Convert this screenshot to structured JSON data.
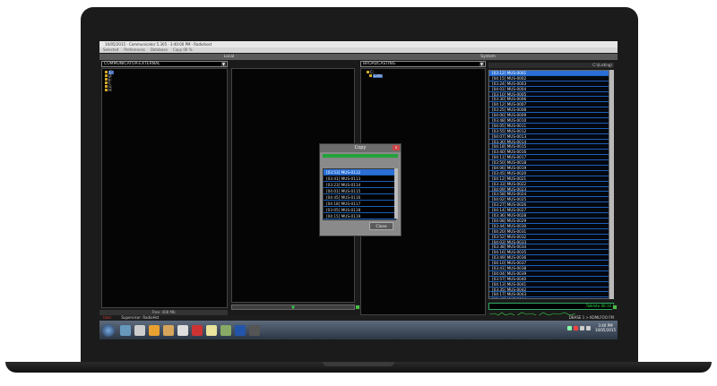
{
  "window": {
    "title": "10/05/2015 · Communicator 5.305 · 3:40:00 PM · Radiohost"
  },
  "menu": [
    "Selected",
    "Preferences",
    "Database",
    "Copy 00 %"
  ],
  "headers": {
    "local": "Local",
    "system": "System"
  },
  "local": {
    "path": "COMMUNICATOR-EXTERNAL",
    "free": "Free: 408 Mb",
    "tree": [
      "C:",
      "D:",
      "E:",
      "F:",
      "G:",
      "H:"
    ]
  },
  "system": {
    "path": "BROADCASTING",
    "header_right": "C:\\(Listing)",
    "tree": [
      "C:",
      "Lists"
    ],
    "items": [
      "[03:12] MUS-0001",
      "[04:15] MUS-0002",
      "[03:24] MUS-0003",
      "[04:01] MUS-0004",
      "[03:10] MUS-0005",
      "[03:30] MUS-0006",
      "[04:12] MUS-0007",
      "[03:25] MUS-0008",
      "[04:00] MUS-0009",
      "[03:48] MUS-0010",
      "[04:05] MUS-0011",
      "[03:55] MUS-0012",
      "[04:07] MUS-0013",
      "[03:30] MUS-0014",
      "[04:18] MUS-0015",
      "[03:40] MUS-0016",
      "[04:11] MUS-0017",
      "[03:50] MUS-0018",
      "[04:06] MUS-0019",
      "[03:45] MUS-0020",
      "[04:12] MUS-0021",
      "[03:33] MUS-0022",
      "[04:09] MUS-0023",
      "[03:58] MUS-0024",
      "[04:02] MUS-0025",
      "[03:27] MUS-0026",
      "[04:14] MUS-0027",
      "[03:36] MUS-0028",
      "[04:08] MUS-0029",
      "[03:44] MUS-0030",
      "[04:20] MUS-0031",
      "[03:52] MUS-0032",
      "[04:03] MUS-0033",
      "[03:38] MUS-0034",
      "[04:16] MUS-0035",
      "[03:49] MUS-0036",
      "[04:10] MUS-0037",
      "[03:41] MUS-0038",
      "[04:04] MUS-0039",
      "[03:57] MUS-0040",
      "[04:13] MUS-0041",
      "[03:35] MUS-0042",
      "[04:17] MUS-0043",
      "[03:46] MUS-0044",
      "[04:01] MUS-0045",
      "[03:53] MUS-0046",
      "[04:06] MUS-0047",
      "[03:39] MUS-0048"
    ],
    "wave_label": "TalkInto 00:10"
  },
  "dialog": {
    "title": "Copy",
    "close_label": "Close",
    "items": [
      "[03:53] MUS-0112",
      "[03:41] MUS-0113",
      "[03:23] MUS-0114",
      "[04:01] MUS-0115",
      "[04:45] MUS-0116",
      "[04:18] MUS-0117",
      "[03:05] MUS-0118",
      "[04:15] MUS-0119"
    ]
  },
  "status": {
    "user": "User",
    "supervisor": "Supervisor: RadioHst",
    "right": "DBASE 1 > KOMLFOO FM"
  },
  "taskbar": {
    "time": "3:40 PM",
    "date": "10/05/2015"
  }
}
